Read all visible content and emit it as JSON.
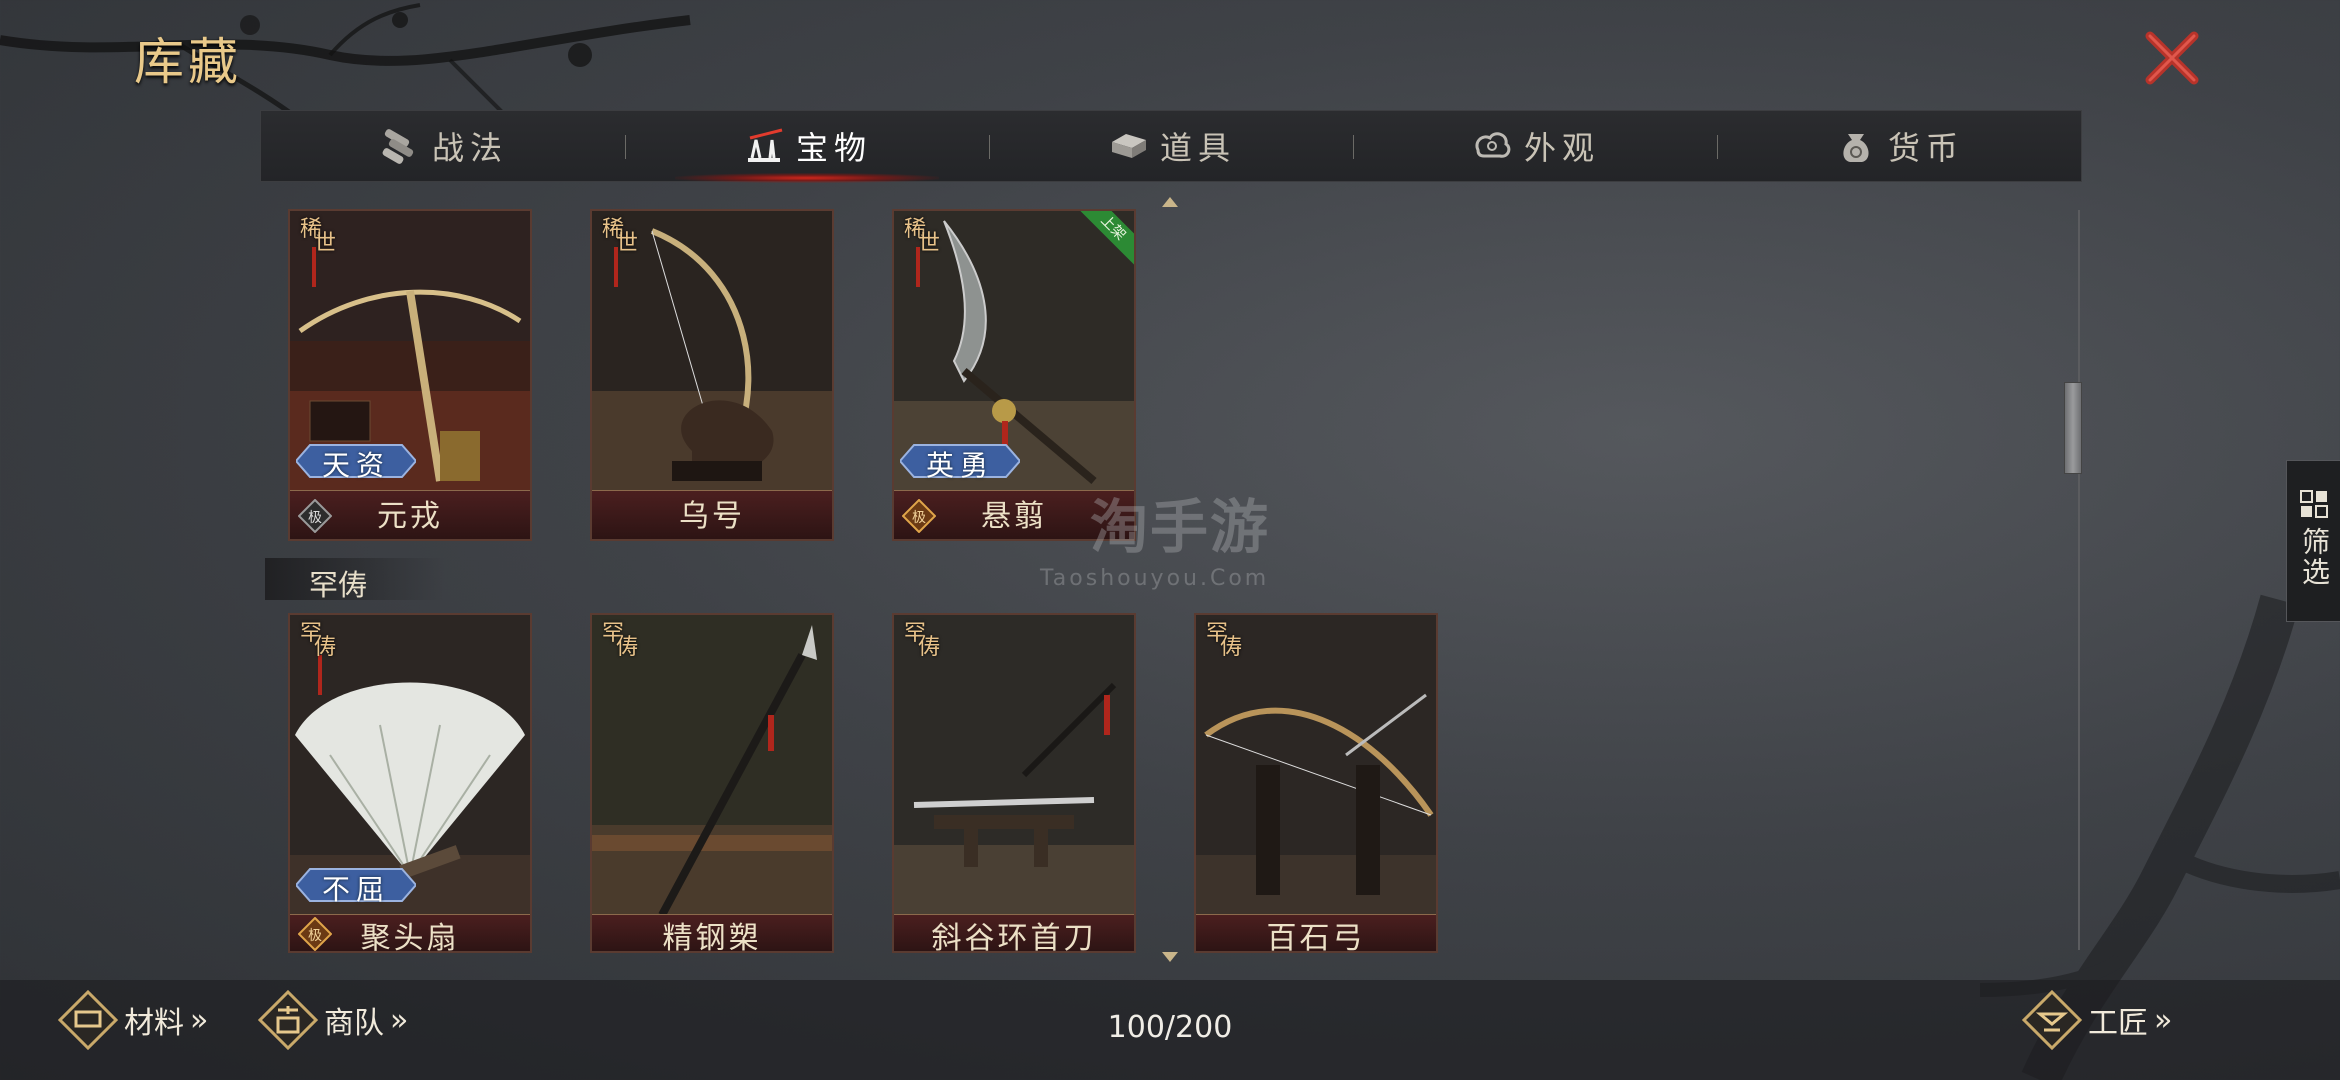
{
  "header": {
    "title": "库藏"
  },
  "tabs": [
    {
      "label": "战法",
      "icon": "scroll-bundle-icon"
    },
    {
      "label": "宝物",
      "icon": "weapon-rack-icon",
      "active": true
    },
    {
      "label": "道具",
      "icon": "silver-ingot-icon"
    },
    {
      "label": "外观",
      "icon": "cloud-swirl-icon"
    },
    {
      "label": "货币",
      "icon": "money-bag-icon"
    }
  ],
  "rare_items": [
    {
      "name": "元戎",
      "rarity": [
        "稀",
        "世"
      ],
      "trait": "天资",
      "grade_icon": "极"
    },
    {
      "name": "乌号",
      "rarity": [
        "稀",
        "世"
      ]
    },
    {
      "name": "悬翦",
      "rarity": [
        "稀",
        "世"
      ],
      "trait": "英勇",
      "grade_icon": "极",
      "ribbon": "上架"
    }
  ],
  "section": {
    "label": "罕俦"
  },
  "uncommon_items": [
    {
      "name": "聚头扇",
      "rarity": [
        "罕",
        "俦"
      ],
      "trait": "不屈",
      "grade_icon": "极"
    },
    {
      "name": "精钢槊",
      "rarity": [
        "罕",
        "俦"
      ]
    },
    {
      "name": "斜谷环首刀",
      "rarity": [
        "罕",
        "俦"
      ]
    },
    {
      "name": "百石弓",
      "rarity": [
        "罕",
        "俦"
      ]
    }
  ],
  "filter": {
    "label": "筛选"
  },
  "watermark": {
    "main": "淘手游",
    "sub": "Taoshouyou.Com"
  },
  "footer": {
    "materials_label": "材料",
    "caravan_label": "商队",
    "capacity": "100/200",
    "craftsman_label": "工匠"
  },
  "colors": {
    "accent_gold": "#e9c98a",
    "close_red": "#c0392b",
    "tab_active_glow": "#d0261c",
    "ribbon_green": "#2c8a34"
  }
}
